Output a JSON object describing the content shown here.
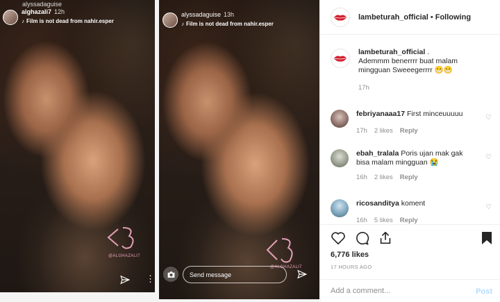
{
  "stories": [
    {
      "top_username": "alyssadaguise",
      "username": "alghazali7",
      "time": "12h",
      "music": "Film is not dead from nahir.esper",
      "mention": "@ALGHAZALI7"
    },
    {
      "username": "alyssadaguise",
      "time": "13h",
      "music": "Film is not dead from nahir.esper",
      "mention": "@ALGHAZALI7",
      "message_placeholder": "Send message"
    }
  ],
  "post": {
    "username": "lambeturah_official",
    "separator": "•",
    "follow_status": "Following",
    "caption": {
      "username": "lambeturah_official",
      "text_suffix": ".",
      "text": "Ademmm benerrrr buat malam mingguan Sweeegerrrr 😁😁",
      "time": "17h"
    },
    "comments": [
      {
        "username": "febriyanaaa17",
        "text": "First minceuuuuu",
        "time": "17h",
        "likes": "2 likes",
        "reply": "Reply"
      },
      {
        "username": "ebah_tralala",
        "text": "Poris ujan mak gak bisa malam mingguan 😭",
        "time": "16h",
        "likes": "2 likes",
        "reply": "Reply"
      },
      {
        "username": "ricosanditya",
        "text": "koment",
        "time": "16h",
        "likes": "5 likes",
        "reply": "Reply"
      }
    ],
    "likes": "6,776 likes",
    "time_ago": "17 HOURS AGO",
    "add_comment_placeholder": "Add a comment...",
    "post_label": "Post"
  },
  "colors": {
    "link_blue_disabled": "#b3dbff",
    "text": "#262626",
    "muted": "#8e8e8e",
    "logo_red": "#d3202f"
  }
}
